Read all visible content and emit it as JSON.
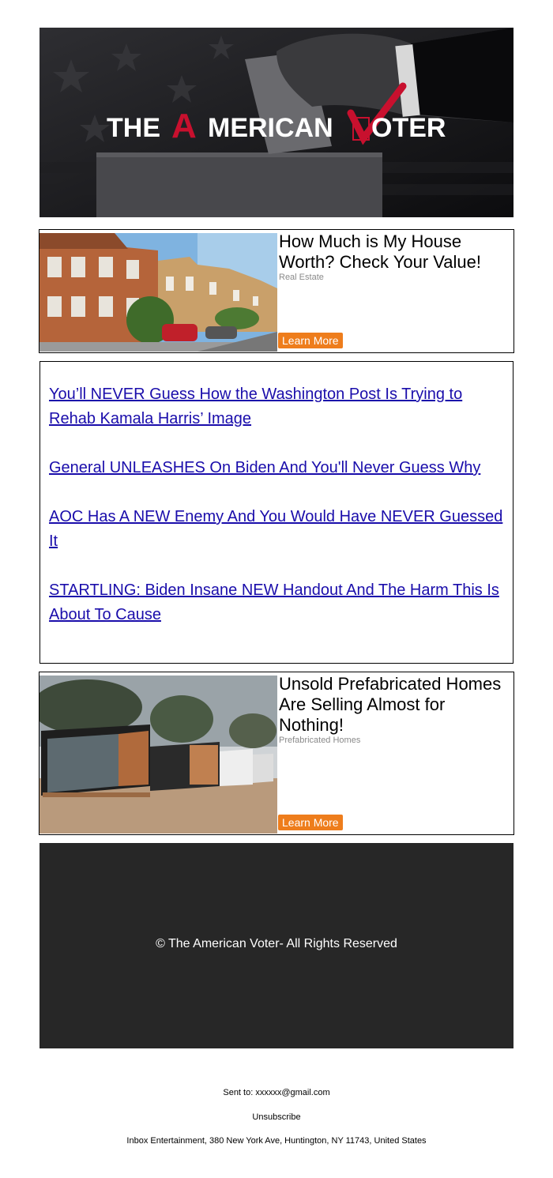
{
  "hero": {
    "logo_the": "THE",
    "logo_a": "A",
    "logo_merican": "MERICAN",
    "logo_v": "V",
    "logo_oter": "OTER",
    "colors": {
      "red": "#c8102e",
      "white": "#ffffff",
      "background": "#141416"
    }
  },
  "ad1": {
    "title": "How Much is My House Worth? Check Your Value!",
    "category": "Real Estate",
    "button": "Learn More",
    "image": "houses-street-photo"
  },
  "news": {
    "links": [
      "You’ll NEVER Guess How the Washington Post Is Trying to Rehab Kamala Harris’ Image",
      "General UNLEASHES On Biden And You'll Never Guess Why",
      "AOC Has A NEW Enemy And You Would Have NEVER Guessed It",
      "STARTLING: Biden Insane NEW Handout And The Harm This Is About To Cause"
    ]
  },
  "ad2": {
    "title": "Unsold Prefabricated Homes Are Selling Almost for Nothing!",
    "category": "Prefabricated Homes",
    "button": "Learn More",
    "image": "prefab-homes-photo"
  },
  "footer": {
    "copyright": "© The American Voter- All Rights Reserved",
    "sent_to": "Sent to: xxxxxx@gmail.com",
    "unsubscribe": "Unsubscribe",
    "address": "Inbox Entertainment, 380 New York Ave, Huntington, NY 11743, United States"
  },
  "colors": {
    "button": "#ee7d1c",
    "link": "#1a0dab",
    "footer_bg": "#272727"
  }
}
